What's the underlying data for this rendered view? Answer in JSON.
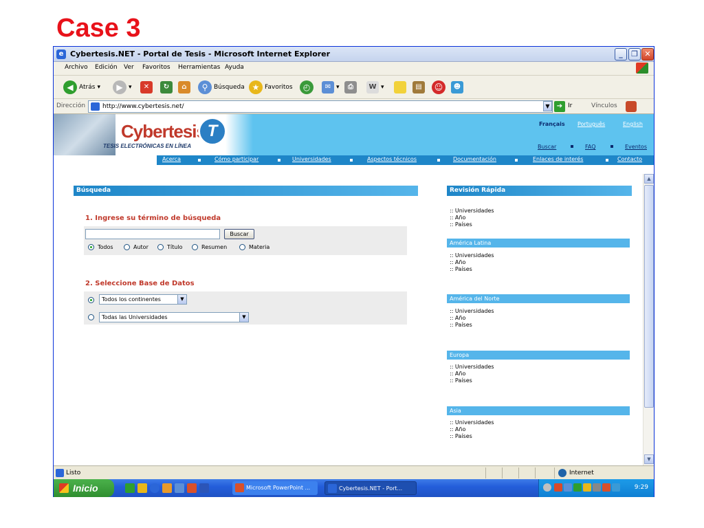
{
  "slide": {
    "title": "Case 3"
  },
  "window": {
    "title": "Cybertesis.NET - Portal de Tesis - Microsoft Internet Explorer",
    "menu": [
      "Archivo",
      "Edición",
      "Ver",
      "Favoritos",
      "Herramientas",
      "Ayuda"
    ],
    "toolbar": {
      "back": "Atrás",
      "search": "Búsqueda",
      "favorites": "Favoritos"
    },
    "address": {
      "label": "Dirección",
      "url": "http://www.cybertesis.net/",
      "go": "Ir",
      "links": "Vínculos"
    },
    "status": {
      "text": "Listo",
      "zone": "Internet"
    }
  },
  "site": {
    "logo": {
      "name": "Cybertesis",
      "tagline": "TESIS ELECTRÓNICAS EN LÍNEA",
      "badge": "T"
    },
    "languages": [
      "Français",
      "Português",
      "English"
    ],
    "top_links": [
      "Buscar",
      "FAQ",
      "Eventos"
    ],
    "nav": [
      "Acerca",
      "Cómo participar",
      "Universidades",
      "Aspectos técnicos",
      "Documentación",
      "Enlaces de interés",
      "Contacto"
    ]
  },
  "search": {
    "heading": "Búsqueda",
    "step1": "1. Ingrese su término de búsqueda",
    "button": "Buscar",
    "input_value": "",
    "options": [
      "Todos",
      "Autor",
      "Título",
      "Resumen",
      "Materia"
    ],
    "selected_option": "Todos",
    "step2": "2. Seleccione Base de Datos",
    "continent_select": "Todos los continentes",
    "university_select": "Todas las Universidades"
  },
  "quick": {
    "heading": "Revisión Rápida",
    "general": [
      ":: Universidades",
      ":: Año",
      ":: Países"
    ],
    "regions": [
      {
        "name": "América Latina",
        "items": [
          ":: Universidades",
          ":: Año",
          ":: Países"
        ]
      },
      {
        "name": "América del Norte",
        "items": [
          ":: Universidades",
          ":: Año",
          ":: Países"
        ]
      },
      {
        "name": "Europa",
        "items": [
          ":: Universidades",
          ":: Año",
          ":: Países"
        ]
      },
      {
        "name": "Asia",
        "items": [
          ":: Universidades",
          ":: Año",
          ":: Países"
        ]
      }
    ]
  },
  "taskbar": {
    "start": "Inicio",
    "tasks": [
      "Microsoft PowerPoint ...",
      "Cybertesis.NET - Port..."
    ],
    "clock": "9:29"
  },
  "colors": {
    "slide_title": "#e8121a",
    "header_blue": "#5ec3ef",
    "nav_blue": "#1e86c8",
    "accent_red": "#c0392b"
  }
}
